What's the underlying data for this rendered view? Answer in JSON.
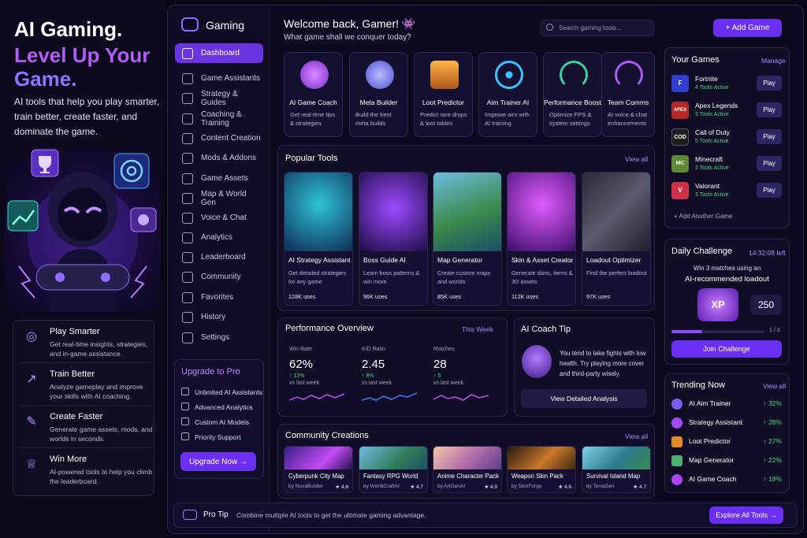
{
  "hero": {
    "title1": "AI Gaming.",
    "title2": "Level Up Your",
    "title3": "Game.",
    "description": "AI tools that help you play smarter, train better, create faster, and dominate the game.",
    "features": [
      {
        "title": "Play Smarter",
        "desc": "Get real-time insights, strategies, and in-game assistance.",
        "icon": "target-icon"
      },
      {
        "title": "Train Better",
        "desc": "Analyze gameplay and improve your skills with AI coaching.",
        "icon": "trend-up-icon"
      },
      {
        "title": "Create Faster",
        "desc": "Generate game assets, mods, and worlds in seconds.",
        "icon": "pen-icon"
      },
      {
        "title": "Win More",
        "desc": "AI-powered tools to help you climb the leaderboard.",
        "icon": "trophy-icon"
      }
    ]
  },
  "sidebar": {
    "brand": "Gaming",
    "items": [
      {
        "label": "Dashboard",
        "active": true
      },
      {
        "label": "Game Assistants"
      },
      {
        "label": "Strategy & Guides"
      },
      {
        "label": "Coaching & Training"
      },
      {
        "label": "Content Creation"
      },
      {
        "label": "Mods & Addons"
      },
      {
        "label": "Game Assets"
      },
      {
        "label": "Map & World Gen"
      },
      {
        "label": "Voice & Chat"
      },
      {
        "label": "Analytics"
      },
      {
        "label": "Leaderboard"
      },
      {
        "label": "Community"
      },
      {
        "label": "Favorites"
      },
      {
        "label": "History"
      },
      {
        "label": "Settings"
      }
    ],
    "upgrade": {
      "title": "Upgrade to Pro",
      "items": [
        "Unlimited AI Assistants",
        "Advanced Analytics",
        "Custom AI Models",
        "Priority Support"
      ],
      "button": "Upgrade Now →"
    }
  },
  "header": {
    "welcome": "Welcome back, Gamer! 👾",
    "subtitle": "What game shall we conquer today?",
    "search_placeholder": "Search gaming tools...",
    "add_game": "+ Add Game"
  },
  "top_tools": [
    {
      "title": "AI Game Coach",
      "desc": "Get real-time tips & strategies",
      "icon": "brain-icon",
      "color": "#b046f0"
    },
    {
      "title": "Meta Builder",
      "desc": "Build the best meta builds",
      "icon": "swords-icon",
      "color": "#7c7ff6"
    },
    {
      "title": "Loot Predictor",
      "desc": "Predict rare drops & loot tables",
      "icon": "chest-icon",
      "color": "#f09a28"
    },
    {
      "title": "Aim Trainer AI",
      "desc": "Improve aim with AI training",
      "icon": "crosshair-icon",
      "color": "#2ab5f5"
    },
    {
      "title": "Performance Boost",
      "desc": "Optimize FPS & system settings",
      "icon": "gauge-icon",
      "color": "#33d49a"
    },
    {
      "title": "Team Comms",
      "desc": "AI voice & chat enhancements",
      "icon": "headset-icon",
      "color": "#b05af5"
    }
  ],
  "popular": {
    "title": "Popular Tools",
    "view_all": "View all",
    "items": [
      {
        "title": "AI Strategy Assistant",
        "desc": "Get detailed strategies for any game",
        "uses": "128K uses",
        "color": "#1d6f86"
      },
      {
        "title": "Boss Guide AI",
        "desc": "Learn boss patterns & win more",
        "uses": "96K uses",
        "color": "#5a2ba8"
      },
      {
        "title": "Map Generator",
        "desc": "Create custom maps and worlds",
        "uses": "85K uses",
        "color": "#2e7a4a"
      },
      {
        "title": "Skin & Asset Creator",
        "desc": "Generate skins, items & 3D assets",
        "uses": "112K uses",
        "color": "#8b2db8"
      },
      {
        "title": "Loadout Optimizer",
        "desc": "Find the perfect loadout",
        "uses": "97K uses",
        "color": "#4a4a5a"
      }
    ]
  },
  "performance": {
    "title": "Performance Overview",
    "period": "This Week",
    "stats": [
      {
        "label": "Win Rate",
        "value": "62%",
        "change": "↑ 12%",
        "note": "vs last week",
        "color": "#c24cf5"
      },
      {
        "label": "K/D Ratio",
        "value": "2.45",
        "change": "↑ 8%",
        "note": "vs last week",
        "color": "#3d7cf5"
      },
      {
        "label": "Matches",
        "value": "28",
        "change": "↑ 5",
        "note": "vs last week",
        "color": "#c24cf5"
      }
    ]
  },
  "coach_tip": {
    "title": "AI Coach Tip",
    "text": "You tend to take fights with low health. Try playing more cover and third-party wisely.",
    "button": "View Detailed Analysis"
  },
  "community": {
    "title": "Community Creations",
    "view_all": "View all",
    "items": [
      {
        "title": "Cyberpunk City Map",
        "by": "by NovaBuilder",
        "rating": "★ 4.6",
        "color": "#4c2d9a"
      },
      {
        "title": "Fantasy RPG World",
        "by": "by WorldCraftAI",
        "rating": "★ 4.7",
        "color": "#2f7a56"
      },
      {
        "title": "Anime Character Pack",
        "by": "by ArtGenAI",
        "rating": "★ 4.9",
        "color": "#b06aa8"
      },
      {
        "title": "Weapon Skin Pack",
        "by": "by SkinForge",
        "rating": "★ 4.6",
        "color": "#9a5a24"
      },
      {
        "title": "Survival Island Map",
        "by": "by TerraGen",
        "rating": "★ 4.7",
        "color": "#2d7a8a"
      }
    ]
  },
  "your_games": {
    "title": "Your Games",
    "manage": "Manage",
    "items": [
      {
        "name": "Fortnite",
        "active": "4 Tools Active",
        "badge": "F",
        "color": "#2f3fd1"
      },
      {
        "name": "Apex Legends",
        "active": "3 Tools Active",
        "badge": "APEX",
        "color": "#b62727"
      },
      {
        "name": "Call of Duty",
        "active": "5 Tools Active",
        "badge": "COD",
        "color": "#1e1e1e"
      },
      {
        "name": "Minecraft",
        "active": "2 Tools Active",
        "badge": "MC",
        "color": "#5f8a35"
      },
      {
        "name": "Valorant",
        "active": "3 Tools Active",
        "badge": "V",
        "color": "#d0324a"
      }
    ],
    "play": "Play",
    "add_another": "+ Add Another Game"
  },
  "challenge": {
    "title": "Daily Challenge",
    "timer": "14:32:08 left",
    "line1": "Win 3 matches using an",
    "line2": "AI-recommended loadout",
    "badge": "XP",
    "points": "250",
    "progress_text": "1 / 3",
    "progress": 0.33,
    "button": "Join Challenge"
  },
  "trending": {
    "title": "Trending Now",
    "view_all": "View all",
    "items": [
      {
        "name": "AI Aim Trainer",
        "value": "↑ 32%",
        "color": "#7c5cf0"
      },
      {
        "name": "Strategy Assistant",
        "value": "↑ 28%",
        "color": "#a24cf0"
      },
      {
        "name": "Loot Predictor",
        "value": "↑ 27%",
        "color": "#e08a28"
      },
      {
        "name": "Map Generator",
        "value": "↑ 22%",
        "color": "#4ab070"
      },
      {
        "name": "AI Game Coach",
        "value": "↑ 18%",
        "color": "#b046f0"
      }
    ]
  },
  "protip": {
    "label": "Pro Tip",
    "text": "Combine multiple AI tools to get the ultimate gaming advantage.",
    "button": "Explore All Tools →"
  }
}
